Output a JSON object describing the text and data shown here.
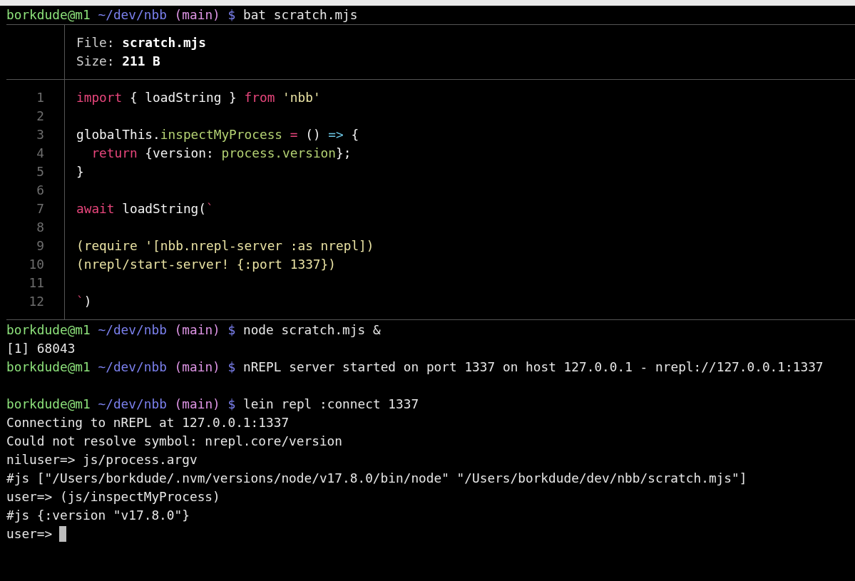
{
  "blocks": [
    {
      "kind": "prompt",
      "user": "borkdude@m1",
      "path": "~/dev/nbb",
      "branch": "(main)",
      "symbol": "$",
      "command": "bat scratch.mjs"
    },
    {
      "kind": "bat",
      "header": [
        {
          "label": "File:",
          "value": "scratch.mjs"
        },
        {
          "label": "Size:",
          "value": "211 B"
        }
      ],
      "lines": [
        {
          "number": "1",
          "tokens": [
            {
              "kind": "keyword",
              "text": "import"
            },
            {
              "kind": "plain",
              "text": " { loadString } "
            },
            {
              "kind": "keyword",
              "text": "from"
            },
            {
              "kind": "string",
              "text": " 'nbb'"
            }
          ]
        },
        {
          "number": "2"
        },
        {
          "number": "3",
          "tokens": [
            {
              "kind": "plain",
              "text": "globalThis."
            },
            {
              "kind": "func",
              "text": "inspectMyProcess "
            },
            {
              "kind": "keyword",
              "text": "="
            },
            {
              "kind": "plain",
              "text": " () "
            },
            {
              "kind": "arrow",
              "text": "=>"
            },
            {
              "kind": "plain",
              "text": " {"
            }
          ]
        },
        {
          "number": "4",
          "tokens": [
            {
              "kind": "keyword",
              "text": "  return"
            },
            {
              "kind": "plain",
              "text": " {version: "
            },
            {
              "kind": "func",
              "text": "process.version"
            },
            {
              "kind": "plain",
              "text": "};"
            }
          ]
        },
        {
          "number": "5",
          "tokens": [
            {
              "kind": "plain",
              "text": "}"
            }
          ]
        },
        {
          "number": "6"
        },
        {
          "number": "7",
          "tokens": [
            {
              "kind": "keyword",
              "text": "await"
            },
            {
              "kind": "plain",
              "text": " loadString("
            },
            {
              "kind": "template",
              "text": "`"
            }
          ]
        },
        {
          "number": "8"
        },
        {
          "number": "9",
          "tokens": [
            {
              "kind": "string",
              "text": "(require '[nbb.nrepl-server :as nrepl])"
            }
          ]
        },
        {
          "number": "10",
          "tokens": [
            {
              "kind": "string",
              "text": "(nrepl/start-server! {:port 1337})"
            }
          ]
        },
        {
          "number": "11"
        },
        {
          "number": "12",
          "tokens": [
            {
              "kind": "template",
              "text": "`"
            },
            {
              "kind": "plain",
              "text": ")"
            }
          ]
        }
      ]
    },
    {
      "kind": "prompt",
      "user": "borkdude@m1",
      "path": "~/dev/nbb",
      "branch": "(main)",
      "symbol": "$",
      "command": "node scratch.mjs &"
    },
    {
      "kind": "output",
      "text": "[1] 68043"
    },
    {
      "kind": "prompt",
      "user": "borkdude@m1",
      "path": "~/dev/nbb",
      "branch": "(main)",
      "symbol": "$",
      "command": "nREPL server started on port 1337 on host 127.0.0.1 - nrepl://127.0.0.1:1337"
    },
    {
      "kind": "blank"
    },
    {
      "kind": "prompt",
      "user": "borkdude@m1",
      "path": "~/dev/nbb",
      "branch": "(main)",
      "symbol": "$",
      "command": "lein repl :connect 1337"
    },
    {
      "kind": "output",
      "text": "Connecting to nREPL at 127.0.0.1:1337"
    },
    {
      "kind": "output",
      "text": "Could not resolve symbol: nrepl.core/version"
    },
    {
      "kind": "output",
      "text": "niluser=> js/process.argv"
    },
    {
      "kind": "output",
      "text": "#js [\"/Users/borkdude/.nvm/versions/node/v17.8.0/bin/node\" \"/Users/borkdude/dev/nbb/scratch.mjs\"]"
    },
    {
      "kind": "output",
      "text": "user=> (js/inspectMyProcess)"
    },
    {
      "kind": "output",
      "text": "#js {:version \"v17.8.0\"}"
    },
    {
      "kind": "input",
      "prompt": "user=>",
      "cursor": true
    }
  ]
}
